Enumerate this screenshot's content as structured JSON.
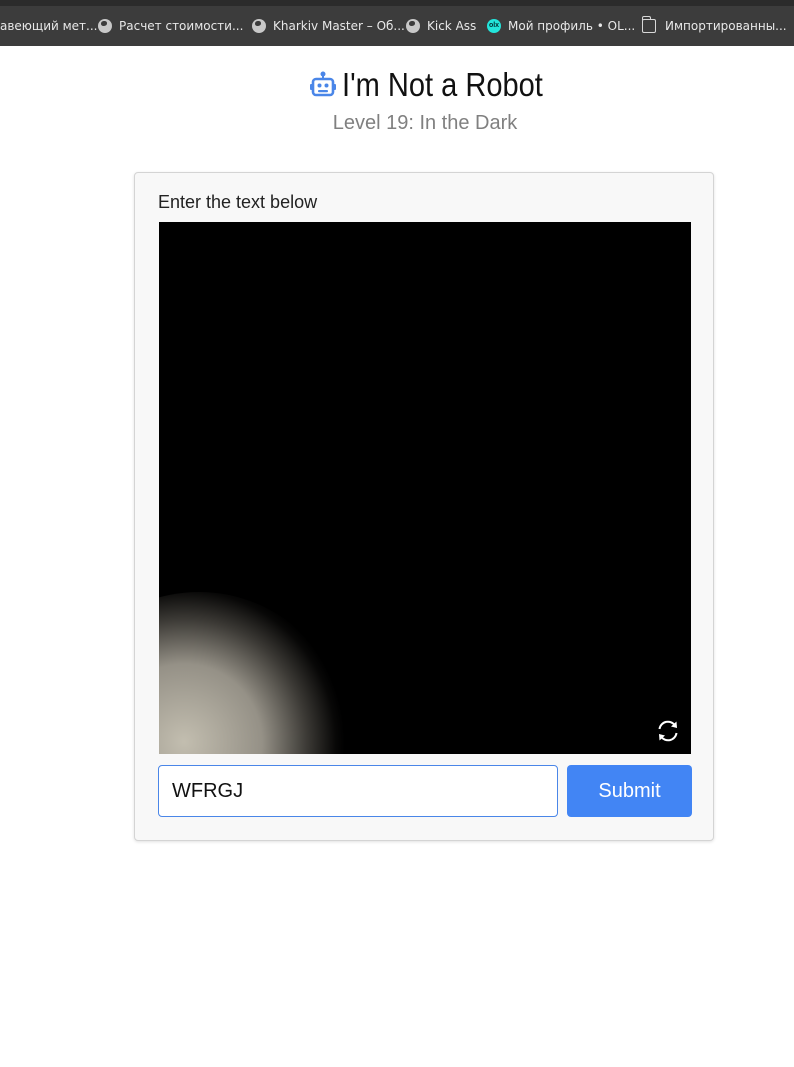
{
  "bookmarks_bar": {
    "items": [
      {
        "label": "авеющий мет...",
        "icon": "none"
      },
      {
        "label": "Расчет стоимости...",
        "icon": "globe-icon"
      },
      {
        "label": "Kharkiv Master – Об...",
        "icon": "globe-icon"
      },
      {
        "label": "Kick Ass",
        "icon": "globe-icon"
      },
      {
        "label": "Мой профиль • OL...",
        "icon": "olx-icon"
      },
      {
        "label": "Импортированны...",
        "icon": "folder-icon"
      }
    ],
    "olx_badge": "olx"
  },
  "header": {
    "title": "I'm Not a Robot",
    "subtitle": "Level 19: In the Dark",
    "icon": "robot-icon",
    "icon_color": "#4a86e8"
  },
  "captcha": {
    "prompt": "Enter the text below",
    "refresh_icon": "refresh-icon"
  },
  "form": {
    "answer_value": "WFRGJ",
    "submit_label": "Submit",
    "accent_color": "#4285f4"
  }
}
